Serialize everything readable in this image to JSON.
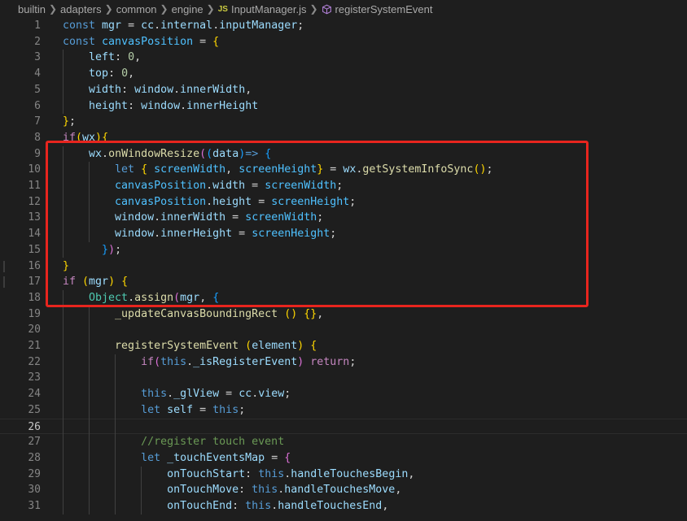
{
  "breadcrumb": {
    "items": [
      "builtin",
      "adapters",
      "common",
      "engine",
      "InputManager.js",
      "registerSystemEvent"
    ],
    "file_icon": "JS",
    "symbol_icon": "method-cube-icon"
  },
  "editor": {
    "active_line": 26,
    "highlight_box_color": "#e8251e",
    "lines": [
      {
        "n": "1",
        "tokens": [
          [
            "kw",
            "const "
          ],
          [
            "v",
            "mgr"
          ],
          [
            "p",
            " = "
          ],
          [
            "v",
            "cc"
          ],
          [
            "p",
            "."
          ],
          [
            "v",
            "internal"
          ],
          [
            "p",
            "."
          ],
          [
            "v",
            "inputManager"
          ],
          [
            "p",
            ";"
          ]
        ]
      },
      {
        "n": "2",
        "tokens": [
          [
            "kw",
            "const "
          ],
          [
            "c",
            "canvasPosition"
          ],
          [
            "p",
            " = "
          ],
          [
            "b1",
            "{"
          ]
        ]
      },
      {
        "n": "3",
        "tokens": [
          [
            "p",
            "    "
          ],
          [
            "v",
            "left"
          ],
          [
            "p",
            ": "
          ],
          [
            "num",
            "0"
          ],
          [
            "p",
            ","
          ]
        ]
      },
      {
        "n": "4",
        "tokens": [
          [
            "p",
            "    "
          ],
          [
            "v",
            "top"
          ],
          [
            "p",
            ": "
          ],
          [
            "num",
            "0"
          ],
          [
            "p",
            ","
          ]
        ]
      },
      {
        "n": "5",
        "tokens": [
          [
            "p",
            "    "
          ],
          [
            "v",
            "width"
          ],
          [
            "p",
            ": "
          ],
          [
            "v",
            "window"
          ],
          [
            "p",
            "."
          ],
          [
            "v",
            "innerWidth"
          ],
          [
            "p",
            ","
          ]
        ]
      },
      {
        "n": "6",
        "tokens": [
          [
            "p",
            "    "
          ],
          [
            "v",
            "height"
          ],
          [
            "p",
            ": "
          ],
          [
            "v",
            "window"
          ],
          [
            "p",
            "."
          ],
          [
            "v",
            "innerHeight"
          ]
        ]
      },
      {
        "n": "7",
        "tokens": [
          [
            "b1",
            "}"
          ],
          [
            "p",
            ";"
          ]
        ]
      },
      {
        "n": "8",
        "tokens": [
          [
            "ctl",
            "if"
          ],
          [
            "b1",
            "("
          ],
          [
            "v",
            "wx"
          ],
          [
            "b1",
            ")"
          ],
          [
            "b1",
            "{"
          ]
        ]
      },
      {
        "n": "9",
        "tokens": [
          [
            "p",
            "    "
          ],
          [
            "v",
            "wx"
          ],
          [
            "p",
            "."
          ],
          [
            "fn",
            "onWindowResize"
          ],
          [
            "b2",
            "("
          ],
          [
            "b3",
            "("
          ],
          [
            "v",
            "data"
          ],
          [
            "b3",
            ")"
          ],
          [
            "kw",
            "=>"
          ],
          [
            "p",
            " "
          ],
          [
            "b3",
            "{"
          ]
        ]
      },
      {
        "n": "10",
        "tokens": [
          [
            "p",
            "        "
          ],
          [
            "kw",
            "let "
          ],
          [
            "b1",
            "{"
          ],
          [
            "p",
            " "
          ],
          [
            "c",
            "screenWidth"
          ],
          [
            "p",
            ", "
          ],
          [
            "c",
            "screenHeight"
          ],
          [
            "b1",
            "}"
          ],
          [
            "p",
            " = "
          ],
          [
            "v",
            "wx"
          ],
          [
            "p",
            "."
          ],
          [
            "fn",
            "getSystemInfoSync"
          ],
          [
            "b1",
            "()"
          ],
          [
            "p",
            ";"
          ]
        ]
      },
      {
        "n": "11",
        "tokens": [
          [
            "p",
            "        "
          ],
          [
            "c",
            "canvasPosition"
          ],
          [
            "p",
            "."
          ],
          [
            "v",
            "width"
          ],
          [
            "p",
            " = "
          ],
          [
            "c",
            "screenWidth"
          ],
          [
            "p",
            ";"
          ]
        ]
      },
      {
        "n": "12",
        "tokens": [
          [
            "p",
            "        "
          ],
          [
            "c",
            "canvasPosition"
          ],
          [
            "p",
            "."
          ],
          [
            "v",
            "height"
          ],
          [
            "p",
            " = "
          ],
          [
            "c",
            "screenHeight"
          ],
          [
            "p",
            ";"
          ]
        ]
      },
      {
        "n": "13",
        "tokens": [
          [
            "p",
            "        "
          ],
          [
            "v",
            "window"
          ],
          [
            "p",
            "."
          ],
          [
            "v",
            "innerWidth"
          ],
          [
            "p",
            " = "
          ],
          [
            "c",
            "screenWidth"
          ],
          [
            "p",
            ";"
          ]
        ]
      },
      {
        "n": "14",
        "tokens": [
          [
            "p",
            "        "
          ],
          [
            "v",
            "window"
          ],
          [
            "p",
            "."
          ],
          [
            "v",
            "innerHeight"
          ],
          [
            "p",
            " = "
          ],
          [
            "c",
            "screenHeight"
          ],
          [
            "p",
            ";"
          ]
        ]
      },
      {
        "n": "15",
        "tokens": [
          [
            "p",
            "      "
          ],
          [
            "b3",
            "}"
          ],
          [
            "b2",
            ")"
          ],
          [
            "p",
            ";"
          ]
        ]
      },
      {
        "n": "16",
        "tokens": [
          [
            "b1",
            "}"
          ]
        ]
      },
      {
        "n": "17",
        "tokens": [
          [
            "ctl",
            "if"
          ],
          [
            "p",
            " "
          ],
          [
            "b1",
            "("
          ],
          [
            "v",
            "mgr"
          ],
          [
            "b1",
            ")"
          ],
          [
            "p",
            " "
          ],
          [
            "b1",
            "{"
          ]
        ]
      },
      {
        "n": "18",
        "tokens": [
          [
            "p",
            "    "
          ],
          [
            "ty",
            "Object"
          ],
          [
            "p",
            "."
          ],
          [
            "fn",
            "assign"
          ],
          [
            "b2",
            "("
          ],
          [
            "v",
            "mgr"
          ],
          [
            "p",
            ", "
          ],
          [
            "b3",
            "{"
          ]
        ]
      },
      {
        "n": "19",
        "tokens": [
          [
            "p",
            "        "
          ],
          [
            "fn",
            "_updateCanvasBoundingRect"
          ],
          [
            "p",
            " "
          ],
          [
            "b1",
            "()"
          ],
          [
            "p",
            " "
          ],
          [
            "b1",
            "{}"
          ],
          [
            "p",
            ","
          ]
        ]
      },
      {
        "n": "20",
        "tokens": []
      },
      {
        "n": "21",
        "tokens": [
          [
            "p",
            "        "
          ],
          [
            "fn",
            "registerSystemEvent"
          ],
          [
            "p",
            " "
          ],
          [
            "b1",
            "("
          ],
          [
            "v",
            "element"
          ],
          [
            "b1",
            ")"
          ],
          [
            "p",
            " "
          ],
          [
            "b1",
            "{"
          ]
        ]
      },
      {
        "n": "22",
        "tokens": [
          [
            "p",
            "            "
          ],
          [
            "ctl",
            "if"
          ],
          [
            "b2",
            "("
          ],
          [
            "kw",
            "this"
          ],
          [
            "p",
            "."
          ],
          [
            "v",
            "_isRegisterEvent"
          ],
          [
            "b2",
            ")"
          ],
          [
            "p",
            " "
          ],
          [
            "ctl",
            "return"
          ],
          [
            "p",
            ";"
          ]
        ]
      },
      {
        "n": "23",
        "tokens": []
      },
      {
        "n": "24",
        "tokens": [
          [
            "p",
            "            "
          ],
          [
            "kw",
            "this"
          ],
          [
            "p",
            "."
          ],
          [
            "v",
            "_glView"
          ],
          [
            "p",
            " = "
          ],
          [
            "v",
            "cc"
          ],
          [
            "p",
            "."
          ],
          [
            "v",
            "view"
          ],
          [
            "p",
            ";"
          ]
        ]
      },
      {
        "n": "25",
        "tokens": [
          [
            "p",
            "            "
          ],
          [
            "kw",
            "let "
          ],
          [
            "v",
            "self"
          ],
          [
            "p",
            " = "
          ],
          [
            "kw",
            "this"
          ],
          [
            "p",
            ";"
          ]
        ]
      },
      {
        "n": "26",
        "tokens": []
      },
      {
        "n": "27",
        "tokens": [
          [
            "p",
            "            "
          ],
          [
            "cm",
            "//register touch event"
          ]
        ]
      },
      {
        "n": "28",
        "tokens": [
          [
            "p",
            "            "
          ],
          [
            "kw",
            "let "
          ],
          [
            "v",
            "_touchEventsMap"
          ],
          [
            "p",
            " = "
          ],
          [
            "b2",
            "{"
          ]
        ]
      },
      {
        "n": "29",
        "tokens": [
          [
            "p",
            "                "
          ],
          [
            "v",
            "onTouchStart"
          ],
          [
            "p",
            ": "
          ],
          [
            "kw",
            "this"
          ],
          [
            "p",
            "."
          ],
          [
            "v",
            "handleTouchesBegin"
          ],
          [
            "p",
            ","
          ]
        ]
      },
      {
        "n": "30",
        "tokens": [
          [
            "p",
            "                "
          ],
          [
            "v",
            "onTouchMove"
          ],
          [
            "p",
            ": "
          ],
          [
            "kw",
            "this"
          ],
          [
            "p",
            "."
          ],
          [
            "v",
            "handleTouchesMove"
          ],
          [
            "p",
            ","
          ]
        ]
      },
      {
        "n": "31",
        "tokens": [
          [
            "p",
            "                "
          ],
          [
            "v",
            "onTouchEnd"
          ],
          [
            "p",
            ": "
          ],
          [
            "kw",
            "this"
          ],
          [
            "p",
            "."
          ],
          [
            "v",
            "handleTouchesEnd"
          ],
          [
            "p",
            ","
          ]
        ]
      }
    ]
  }
}
